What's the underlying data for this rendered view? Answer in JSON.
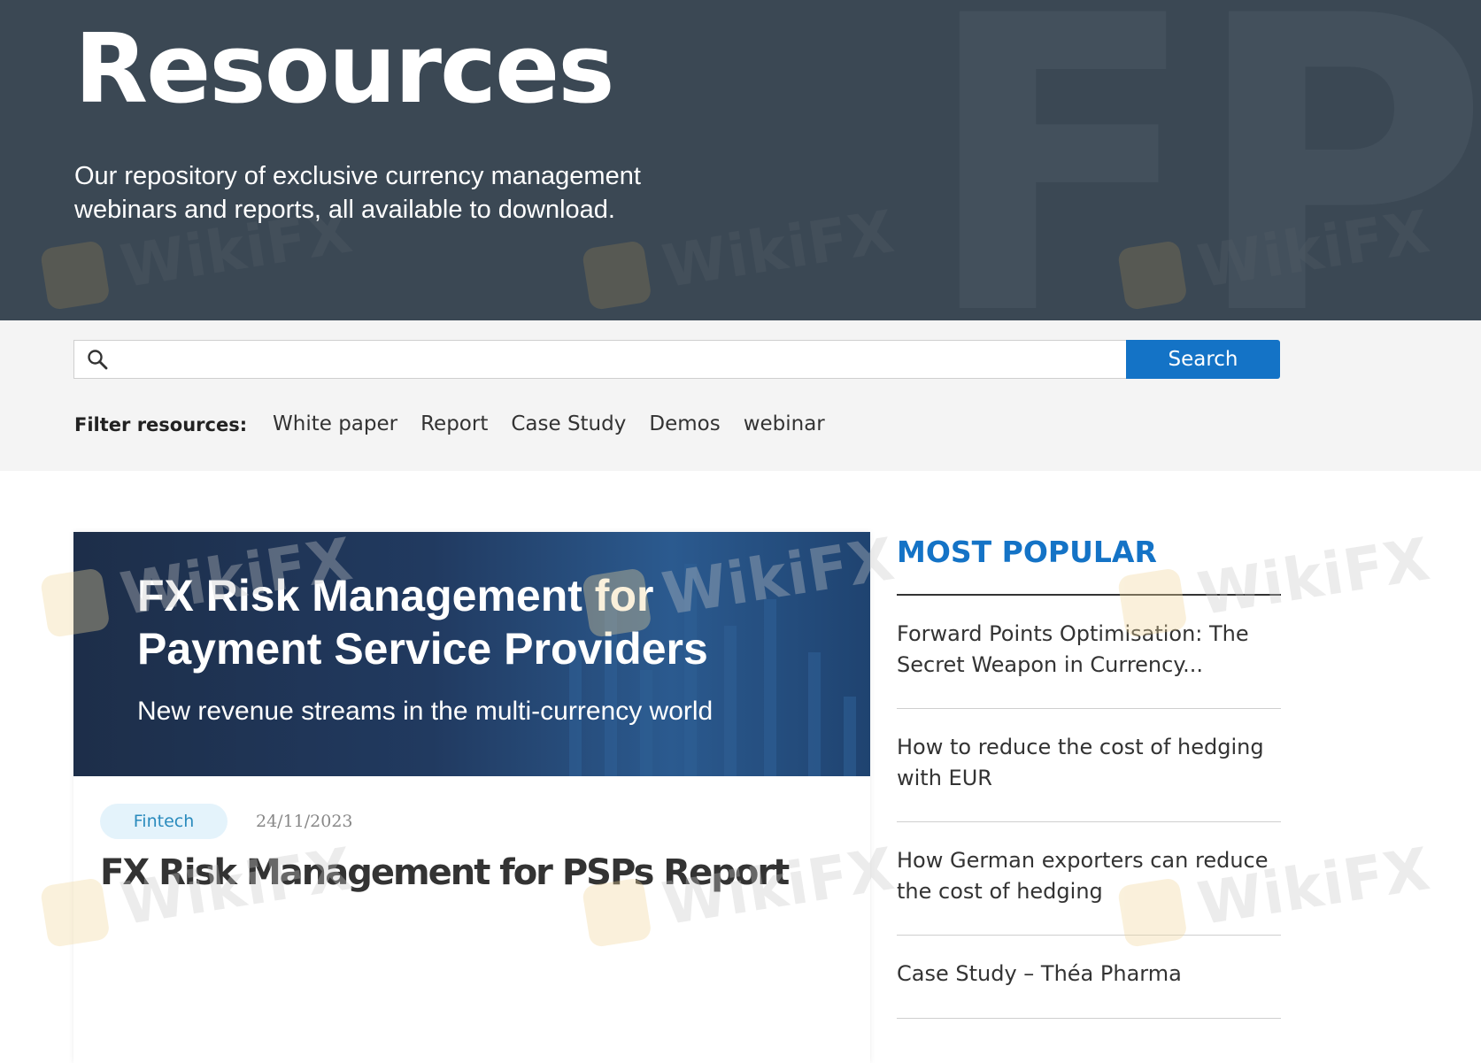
{
  "hero": {
    "title": "Resources",
    "subtitle": "Our repository of exclusive currency management webinars and reports, all available to download."
  },
  "search": {
    "placeholder": "",
    "button_label": "Search"
  },
  "filters": {
    "label": "Filter resources:",
    "items": [
      "White paper",
      "Report",
      "Case Study",
      "Demos",
      "webinar"
    ]
  },
  "card": {
    "image_title": "FX Risk Management for Payment Service Providers",
    "image_subtitle": "New revenue streams in the multi-currency world",
    "tag": "Fintech",
    "date": "24/11/2023",
    "title": "FX Risk Management for PSPs Report"
  },
  "popular": {
    "heading": "MOST POPULAR",
    "items": [
      "Forward Points Optimisation: The Secret Weapon in Currency...",
      "How to reduce the cost of hedging with EUR",
      "How German exporters can reduce the cost of hedging",
      "Case Study – Théa Pharma"
    ]
  },
  "watermark": {
    "text": "WikiFX"
  },
  "colors": {
    "hero_bg": "#3b4854",
    "accent_blue": "#1473c6",
    "tag_bg": "#e4f3fb",
    "tag_text": "#2a8bbd"
  }
}
